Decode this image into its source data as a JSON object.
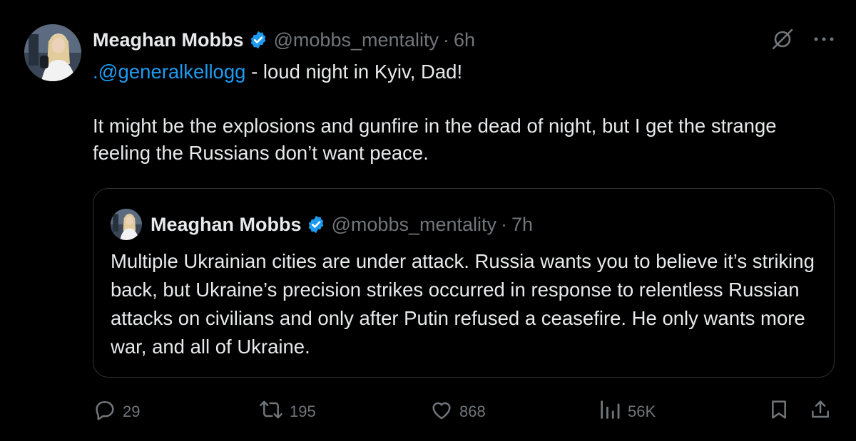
{
  "tweet": {
    "author_name": "Meaghan Mobbs",
    "handle": "@mobbs_mentality",
    "separator": "·",
    "time": "6h",
    "mention": ".@generalkellogg",
    "text_line1_rest": " - loud night in Kyiv, Dad!",
    "text_para2": "It might be the explosions and gunfire in the dead of night, but I get the strange feeling the Russians don’t want peace."
  },
  "quoted_tweet": {
    "author_name": "Meaghan Mobbs",
    "handle": "@mobbs_mentality",
    "separator": "·",
    "time": "7h",
    "text": "Multiple Ukrainian cities are under attack. Russia wants you to believe it’s striking back, but Ukraine’s precision strikes occurred in response to relentless Russian attacks on civilians and only after Putin refused a ceasefire. He only wants more war, and all of Ukraine."
  },
  "actions": {
    "replies": "29",
    "reposts": "195",
    "likes": "868",
    "views": "56K"
  },
  "icons": {
    "verified": "verified-badge-icon",
    "grok": "grok-icon",
    "more": "more-icon",
    "reply": "reply-icon",
    "repost": "repost-icon",
    "like": "like-icon",
    "views": "views-icon",
    "bookmark": "bookmark-icon",
    "share": "share-icon"
  },
  "colors": {
    "background": "#000000",
    "text": "#e7e9ea",
    "muted": "#71767b",
    "link": "#1d9bf0",
    "border": "#2f3336"
  }
}
